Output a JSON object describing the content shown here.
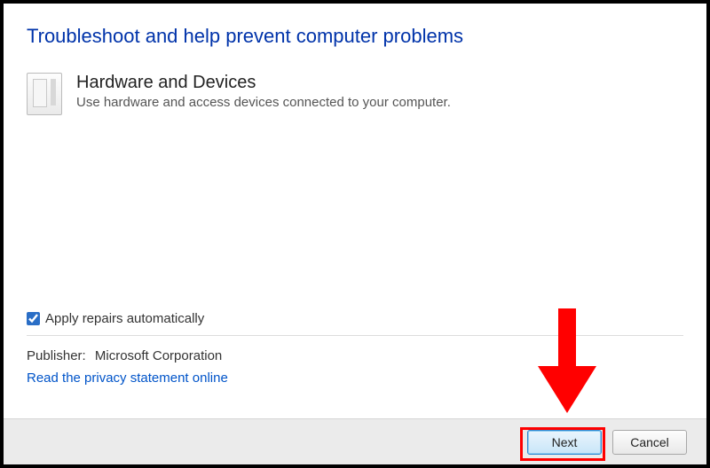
{
  "title": "Troubleshoot and help prevent computer problems",
  "section": {
    "heading": "Hardware and Devices",
    "desc": "Use hardware and access devices connected to your computer."
  },
  "checkbox": {
    "label": "Apply repairs automatically",
    "checked": true
  },
  "publisher": {
    "label": "Publisher:",
    "value": "Microsoft Corporation"
  },
  "privacy_link": "Read the privacy statement online",
  "buttons": {
    "next": "Next",
    "cancel": "Cancel"
  }
}
